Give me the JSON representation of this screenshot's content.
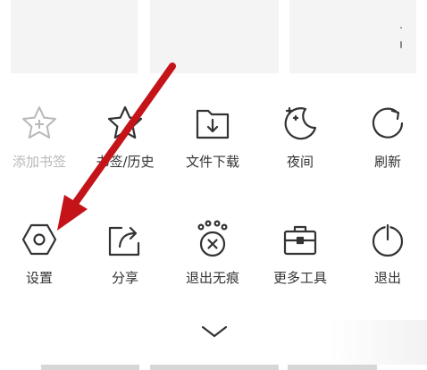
{
  "menu": {
    "row1": [
      {
        "label": "添加书签",
        "icon": "star-add-icon",
        "disabled": true
      },
      {
        "label": "书签/历史",
        "icon": "star-icon",
        "disabled": false
      },
      {
        "label": "文件下载",
        "icon": "folder-download-icon",
        "disabled": false
      },
      {
        "label": "夜间",
        "icon": "moon-icon",
        "disabled": false
      },
      {
        "label": "刷新",
        "icon": "refresh-icon",
        "disabled": false
      }
    ],
    "row2": [
      {
        "label": "设置",
        "icon": "settings-hexagon-icon",
        "disabled": false
      },
      {
        "label": "分享",
        "icon": "share-icon",
        "disabled": false
      },
      {
        "label": "退出无痕",
        "icon": "incognito-exit-icon",
        "disabled": false
      },
      {
        "label": "更多工具",
        "icon": "toolbox-icon",
        "disabled": false
      },
      {
        "label": "退出",
        "icon": "power-icon",
        "disabled": false
      }
    ]
  },
  "colors": {
    "icon_stroke": "#333333",
    "disabled": "#b8b8b8",
    "annotation_arrow": "#c4141a",
    "card_bg": "#f4f4f4"
  }
}
